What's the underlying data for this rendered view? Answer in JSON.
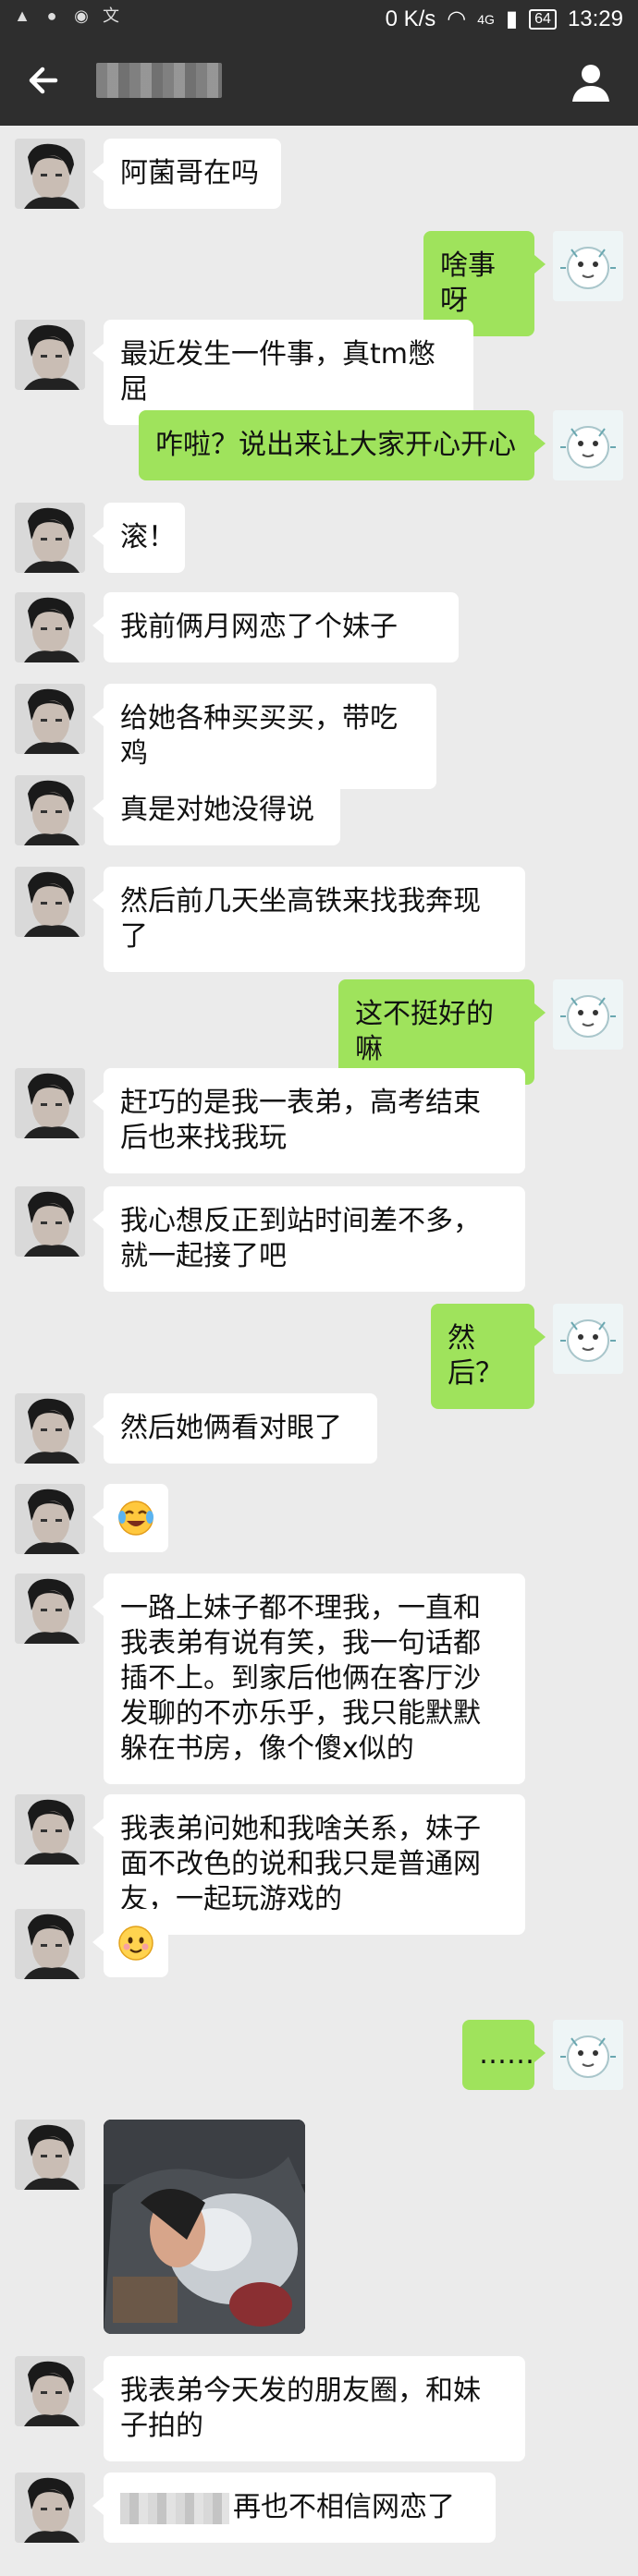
{
  "status_bar": {
    "network_speed": "0 K/s",
    "network_type": "4G",
    "battery": "64",
    "time": "13:29"
  },
  "nav": {
    "back_icon": "arrow-left-icon",
    "profile_icon": "person-icon"
  },
  "messages": [
    {
      "dir": "in",
      "text": "阿菌哥在吗"
    },
    {
      "dir": "out",
      "text": "啥事呀"
    },
    {
      "dir": "in",
      "text": "最近发生一件事，真tm憋屈"
    },
    {
      "dir": "out",
      "text": "咋啦？说出来让大家开心开心"
    },
    {
      "dir": "in",
      "text": "滚！"
    },
    {
      "dir": "in",
      "text": "我前俩月网恋了个妹子"
    },
    {
      "dir": "in",
      "text": "给她各种买买买，带吃鸡"
    },
    {
      "dir": "in",
      "text": "真是对她没得说"
    },
    {
      "dir": "in",
      "text": "然后前几天坐高铁来找我奔现\n了"
    },
    {
      "dir": "out",
      "text": "这不挺好的嘛"
    },
    {
      "dir": "in",
      "text": "赶巧的是我一表弟，高考结束\n后也来找我玩"
    },
    {
      "dir": "in",
      "text": "我心想反正到站时间差不多，\n就一起接了吧"
    },
    {
      "dir": "out",
      "text": "然后？"
    },
    {
      "dir": "in",
      "text": "然后她俩看对眼了"
    },
    {
      "dir": "in",
      "text": "",
      "emoji": "crying-laughing-face-icon"
    },
    {
      "dir": "in",
      "text": "一路上妹子都不理我，一直和\n我表弟有说有笑，我一句话都\n插不上。到家后他俩在客厅沙\n发聊的不亦乐乎，我只能默默\n躲在书房，像个傻x似的"
    },
    {
      "dir": "in",
      "text": "我表弟问她和我啥关系，妹子\n面不改色的说和我只是普通网\n友，一起玩游戏的"
    },
    {
      "dir": "in",
      "text": "",
      "emoji": "smiling-face-icon"
    },
    {
      "dir": "out",
      "text": "……"
    },
    {
      "dir": "in",
      "text": "",
      "image": "photo-icon"
    },
    {
      "dir": "in",
      "text": "我表弟今天发的朋友圈，和妹\n子拍的"
    },
    {
      "dir": "in",
      "text": "再也不相信网恋了"
    }
  ]
}
